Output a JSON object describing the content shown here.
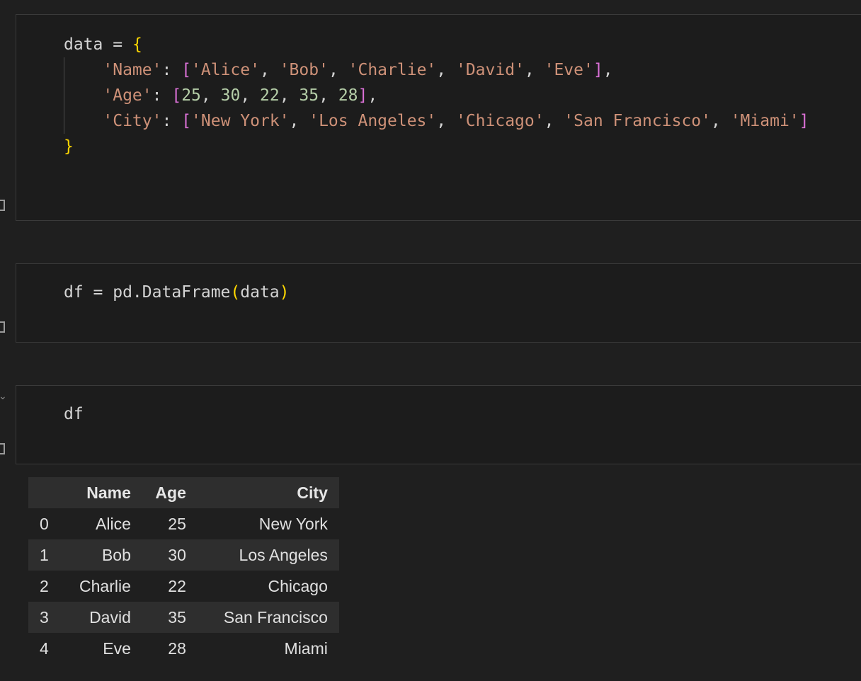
{
  "cells": [
    {
      "lines": [
        [
          {
            "t": "data = ",
            "c": "plain"
          },
          {
            "t": "{",
            "c": "brace"
          }
        ],
        [
          {
            "t": "    ",
            "c": "plain"
          },
          {
            "t": "'Name'",
            "c": "str"
          },
          {
            "t": ": ",
            "c": "plain"
          },
          {
            "t": "[",
            "c": "bracket"
          },
          {
            "t": "'Alice'",
            "c": "str"
          },
          {
            "t": ", ",
            "c": "plain"
          },
          {
            "t": "'Bob'",
            "c": "str"
          },
          {
            "t": ", ",
            "c": "plain"
          },
          {
            "t": "'Charlie'",
            "c": "str"
          },
          {
            "t": ", ",
            "c": "plain"
          },
          {
            "t": "'David'",
            "c": "str"
          },
          {
            "t": ", ",
            "c": "plain"
          },
          {
            "t": "'Eve'",
            "c": "str"
          },
          {
            "t": "]",
            "c": "bracket"
          },
          {
            "t": ",",
            "c": "plain"
          }
        ],
        [
          {
            "t": "    ",
            "c": "plain"
          },
          {
            "t": "'Age'",
            "c": "str"
          },
          {
            "t": ": ",
            "c": "plain"
          },
          {
            "t": "[",
            "c": "bracket"
          },
          {
            "t": "25",
            "c": "num"
          },
          {
            "t": ", ",
            "c": "plain"
          },
          {
            "t": "30",
            "c": "num"
          },
          {
            "t": ", ",
            "c": "plain"
          },
          {
            "t": "22",
            "c": "num"
          },
          {
            "t": ", ",
            "c": "plain"
          },
          {
            "t": "35",
            "c": "num"
          },
          {
            "t": ", ",
            "c": "plain"
          },
          {
            "t": "28",
            "c": "num"
          },
          {
            "t": "]",
            "c": "bracket"
          },
          {
            "t": ",",
            "c": "plain"
          }
        ],
        [
          {
            "t": "    ",
            "c": "plain"
          },
          {
            "t": "'City'",
            "c": "str"
          },
          {
            "t": ": ",
            "c": "plain"
          },
          {
            "t": "[",
            "c": "bracket"
          },
          {
            "t": "'New York'",
            "c": "str"
          },
          {
            "t": ", ",
            "c": "plain"
          },
          {
            "t": "'Los Angeles'",
            "c": "str"
          },
          {
            "t": ", ",
            "c": "plain"
          },
          {
            "t": "'Chicago'",
            "c": "str"
          },
          {
            "t": ", ",
            "c": "plain"
          },
          {
            "t": "'San Francisco'",
            "c": "str"
          },
          {
            "t": ", ",
            "c": "plain"
          },
          {
            "t": "'Miami'",
            "c": "str"
          },
          {
            "t": "]",
            "c": "bracket"
          }
        ],
        [
          {
            "t": "}",
            "c": "brace"
          }
        ]
      ]
    },
    {
      "lines": [
        [
          {
            "t": "df = pd.DataFrame",
            "c": "plain"
          },
          {
            "t": "(",
            "c": "paren"
          },
          {
            "t": "data",
            "c": "plain"
          },
          {
            "t": ")",
            "c": "paren"
          }
        ]
      ]
    },
    {
      "lines": [
        [
          {
            "t": "df",
            "c": "plain"
          }
        ]
      ]
    }
  ],
  "colors": {
    "background": "#1f1f1f",
    "cell_background": "#1c1c1c",
    "string": "#ce9178",
    "number": "#b5cea8",
    "brace": "#ffd700",
    "bracket": "#da70d6",
    "text": "#d4d4d4"
  },
  "icons": {
    "collapse": "chevron-down-icon",
    "exec_marker": "cell-bracket-icon"
  },
  "output_table": {
    "columns": [
      "",
      "Name",
      "Age",
      "City"
    ],
    "rows": [
      [
        "0",
        "Alice",
        "25",
        "New York"
      ],
      [
        "1",
        "Bob",
        "30",
        "Los Angeles"
      ],
      [
        "2",
        "Charlie",
        "22",
        "Chicago"
      ],
      [
        "3",
        "David",
        "35",
        "San Francisco"
      ],
      [
        "4",
        "Eve",
        "28",
        "Miami"
      ]
    ]
  }
}
